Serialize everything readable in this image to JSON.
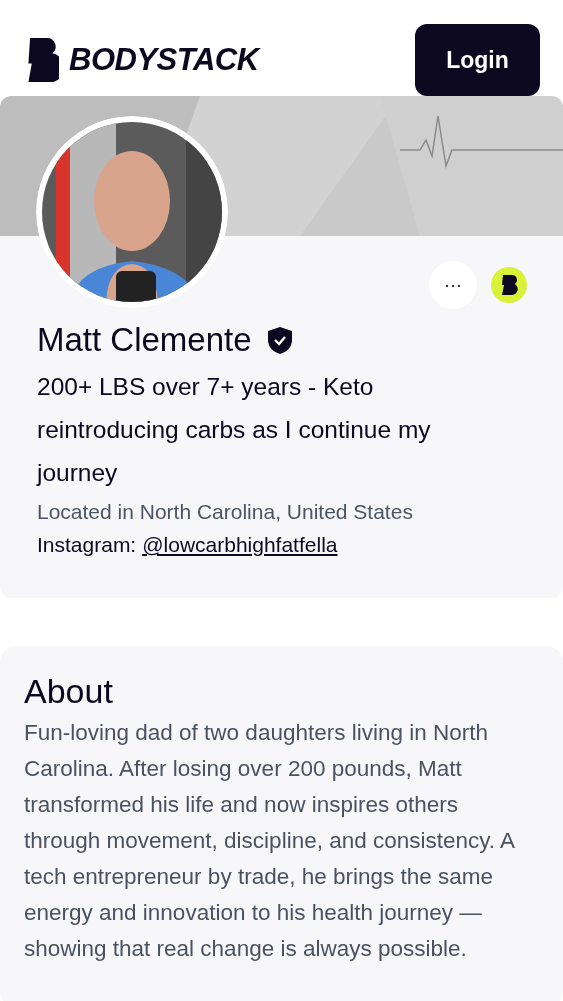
{
  "header": {
    "logo_text": "BODYSTACK",
    "login_button": "Login"
  },
  "profile": {
    "more_button": "···",
    "verified": true,
    "name": "Matt Clemente",
    "bio": "200+ LBS over 7+ years - Keto reintroducing carbs as I continue my journey",
    "location": "Located in North Carolina, United States",
    "instagram_label": "Instagram:",
    "instagram_handle": "@lowcarbhighfatfella"
  },
  "about": {
    "title": "About",
    "text": "Fun-loving dad of two daughters living in North Carolina. After losing over 200 pounds, Matt transformed his life and now inspires others through movement, discipline, and consistency. A tech entrepreneur by trade, he brings the same energy and innovation to his health journey — showing that real change is always possible."
  }
}
